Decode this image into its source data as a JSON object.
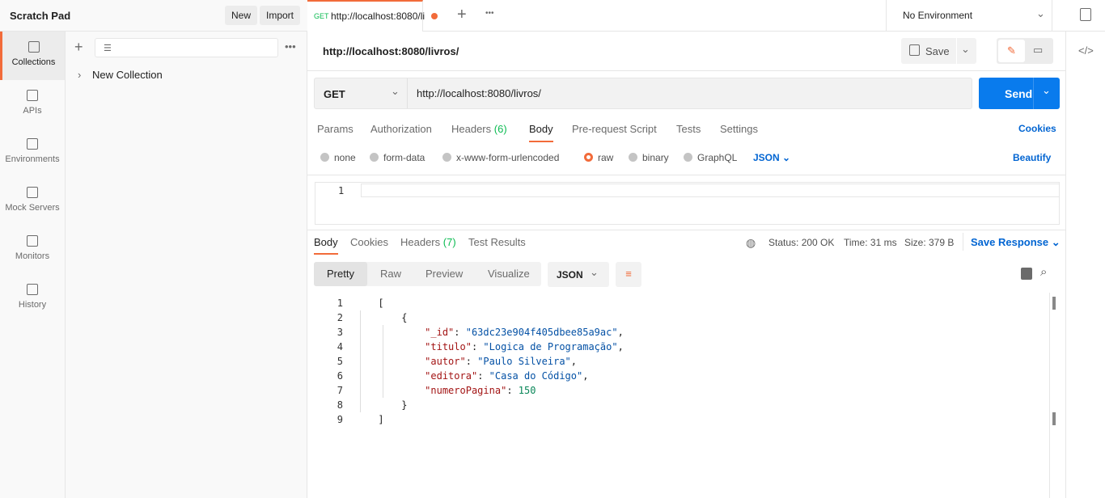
{
  "workspace": {
    "title": "Scratch Pad",
    "new_label": "New",
    "import_label": "Import"
  },
  "rail": [
    {
      "label": "Collections",
      "icon": "collections-icon"
    },
    {
      "label": "APIs",
      "icon": "apis-icon"
    },
    {
      "label": "Environments",
      "icon": "environments-icon"
    },
    {
      "label": "Mock Servers",
      "icon": "mock-servers-icon"
    },
    {
      "label": "Monitors",
      "icon": "monitors-icon"
    },
    {
      "label": "History",
      "icon": "history-icon"
    }
  ],
  "collections": [
    {
      "label": "New Collection"
    }
  ],
  "tab": {
    "method": "GET",
    "title": "http://localhost:8080/li"
  },
  "environment": "No Environment",
  "request": {
    "name": "http://localhost:8080/livros/",
    "save_label": "Save",
    "method": "GET",
    "url": "http://localhost:8080/livros/",
    "send_label": "Send"
  },
  "req_tabs": [
    "Params",
    "Authorization",
    "Headers",
    "Body",
    "Pre-request Script",
    "Tests",
    "Settings"
  ],
  "req_headers_count": "(6)",
  "cookies_label": "Cookies",
  "body_types": [
    "none",
    "form-data",
    "x-www-form-urlencoded",
    "raw",
    "binary",
    "GraphQL"
  ],
  "body_format": "JSON",
  "beautify_label": "Beautify",
  "editor_line": "1",
  "resp_tabs": [
    "Body",
    "Cookies",
    "Headers",
    "Test Results"
  ],
  "resp_headers_count": "(7)",
  "status": {
    "status": "Status: 200 OK",
    "time": "Time: 31 ms",
    "size": "Size: 379 B",
    "save_response": "Save Response"
  },
  "view_modes": [
    "Pretty",
    "Raw",
    "Preview",
    "Visualize"
  ],
  "resp_format": "JSON",
  "response_lines": [
    {
      "n": "1",
      "text": "["
    },
    {
      "n": "2",
      "text": "    {"
    },
    {
      "n": "3",
      "key": "\"_id\"",
      "val": "\"63dc23e904f405dbee85a9ac\"",
      "type": "s",
      "comma": ","
    },
    {
      "n": "4",
      "key": "\"titulo\"",
      "val": "\"Logica de Programação\"",
      "type": "s",
      "comma": ","
    },
    {
      "n": "5",
      "key": "\"autor\"",
      "val": "\"Paulo Silveira\"",
      "type": "s",
      "comma": ","
    },
    {
      "n": "6",
      "key": "\"editora\"",
      "val": "\"Casa do Código\"",
      "type": "s",
      "comma": ","
    },
    {
      "n": "7",
      "key": "\"numeroPagina\"",
      "val": "150",
      "type": "n",
      "comma": ""
    },
    {
      "n": "8",
      "text": "    }"
    },
    {
      "n": "9",
      "text": "]"
    }
  ],
  "colors": {
    "accent": "#f26b3a",
    "send": "#097bed",
    "link": "#0265d2"
  }
}
